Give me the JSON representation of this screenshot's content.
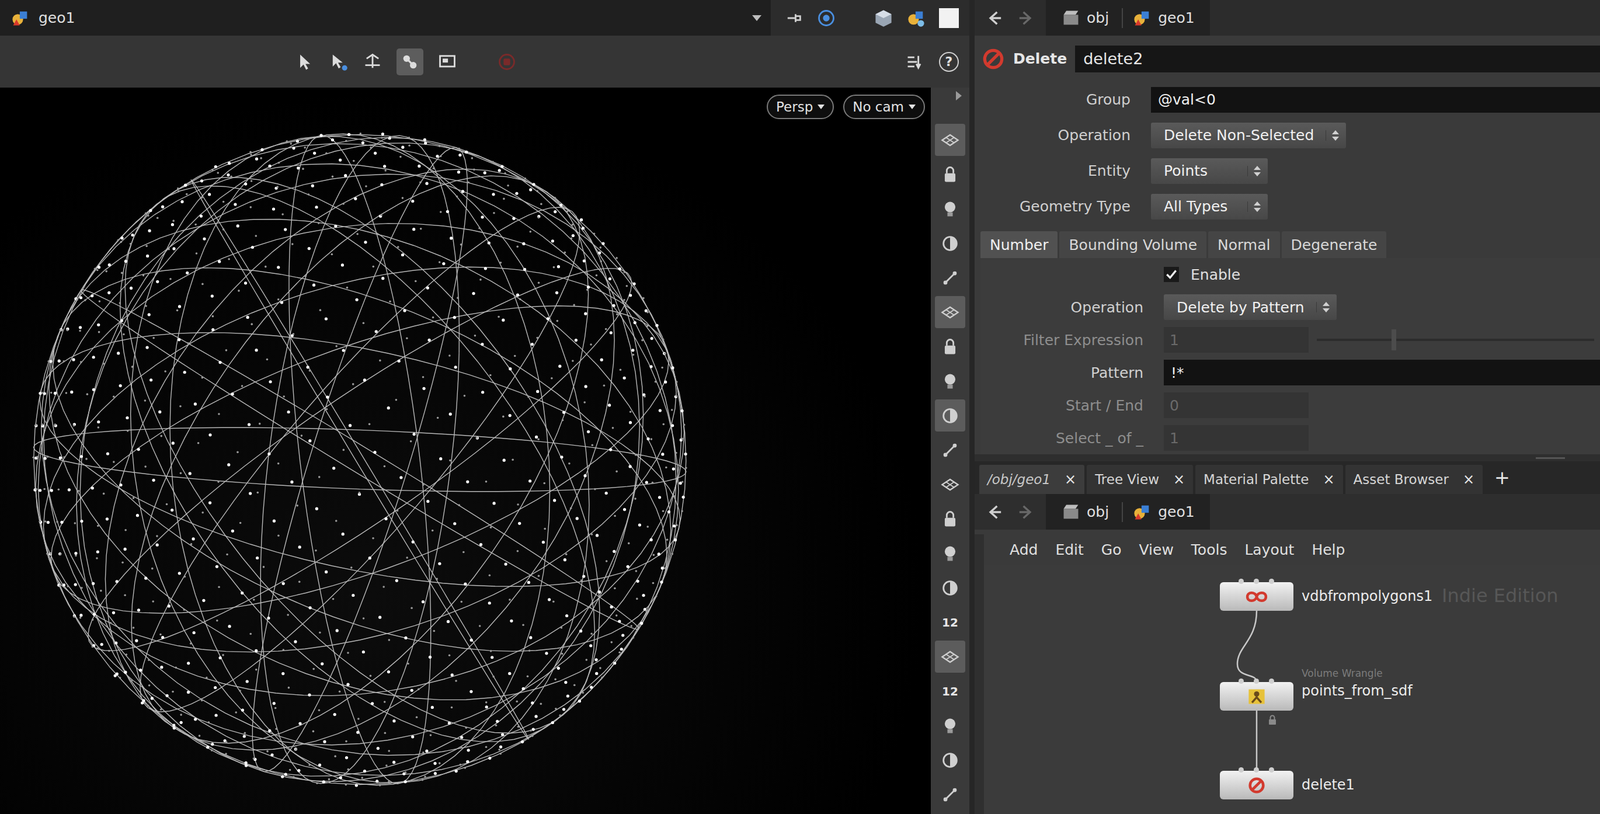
{
  "viewer": {
    "path": "geo1",
    "help": "?",
    "view_menus": [
      {
        "label": "Persp"
      },
      {
        "label": "No cam"
      }
    ],
    "display_toolbar": [
      {
        "kind": "icon",
        "selected": true
      },
      {
        "kind": "icon",
        "selected": false
      },
      {
        "kind": "icon",
        "selected": false
      },
      {
        "kind": "icon",
        "selected": false
      },
      {
        "kind": "icon",
        "selected": false
      },
      {
        "kind": "icon",
        "selected": true
      },
      {
        "kind": "icon",
        "selected": false
      },
      {
        "kind": "icon",
        "selected": false
      },
      {
        "kind": "icon",
        "selected": true
      },
      {
        "kind": "icon",
        "selected": false
      },
      {
        "kind": "icon",
        "selected": false
      },
      {
        "kind": "icon",
        "selected": false
      },
      {
        "kind": "icon",
        "selected": false
      },
      {
        "kind": "icon",
        "selected": false
      },
      {
        "kind": "number",
        "text": "12",
        "selected": false
      },
      {
        "kind": "icon",
        "selected": true
      },
      {
        "kind": "number",
        "text": "12",
        "selected": false
      },
      {
        "kind": "icon",
        "selected": false
      },
      {
        "kind": "icon",
        "selected": false
      },
      {
        "kind": "icon",
        "selected": false
      }
    ]
  },
  "parameters": {
    "path": [
      "obj",
      "geo1"
    ],
    "node_type": "Delete",
    "node_name": "delete2",
    "params": [
      {
        "label": "Group",
        "kind": "text",
        "value": "@val<0"
      },
      {
        "label": "Operation",
        "kind": "menu",
        "value": "Delete Non-Selected"
      },
      {
        "label": "Entity",
        "kind": "menu",
        "value": "Points"
      },
      {
        "label": "Geometry Type",
        "kind": "menu",
        "value": "All Types"
      }
    ],
    "tabs": [
      {
        "label": "Number",
        "selected": true
      },
      {
        "label": "Bounding Volume",
        "selected": false
      },
      {
        "label": "Normal",
        "selected": false
      },
      {
        "label": "Degenerate",
        "selected": false
      }
    ],
    "tab_params": [
      {
        "kind": "checkbox",
        "value": "Enable",
        "checked": true,
        "disabled": false
      },
      {
        "kind": "menu",
        "label": "Operation",
        "value": "Delete by Pattern",
        "disabled": false
      },
      {
        "kind": "slider",
        "label": "Filter Expression",
        "value": "1",
        "level": 0.27,
        "disabled": true
      },
      {
        "kind": "text",
        "label": "Pattern",
        "value": "!*",
        "disabled": false
      },
      {
        "kind": "text",
        "label": "Start / End",
        "value": "0",
        "disabled": true
      },
      {
        "kind": "text",
        "label": "Select _ of _",
        "value": "1",
        "disabled": true
      }
    ]
  },
  "pane_tabs": {
    "close": "×",
    "add": "+",
    "tabs": [
      {
        "label": "/obj/geo1",
        "selected": true
      },
      {
        "label": "Tree View",
        "selected": false
      },
      {
        "label": "Material Palette",
        "selected": false
      },
      {
        "label": "Asset Browser",
        "selected": false
      }
    ]
  },
  "network": {
    "path": [
      "obj",
      "geo1"
    ],
    "menu": [
      "Add",
      "Edit",
      "Go",
      "View",
      "Tools",
      "Layout",
      "Help"
    ],
    "watermark": "Indie Edition",
    "nodes": [
      {
        "name": "vdbfrompolygons1",
        "kind": "vdb",
        "locked": false
      },
      {
        "name": "points_from_sdf",
        "kind": "wrangle",
        "subtitle": "Volume Wrangle",
        "locked": true
      },
      {
        "name": "delete1",
        "kind": "delete",
        "locked": false
      }
    ]
  }
}
